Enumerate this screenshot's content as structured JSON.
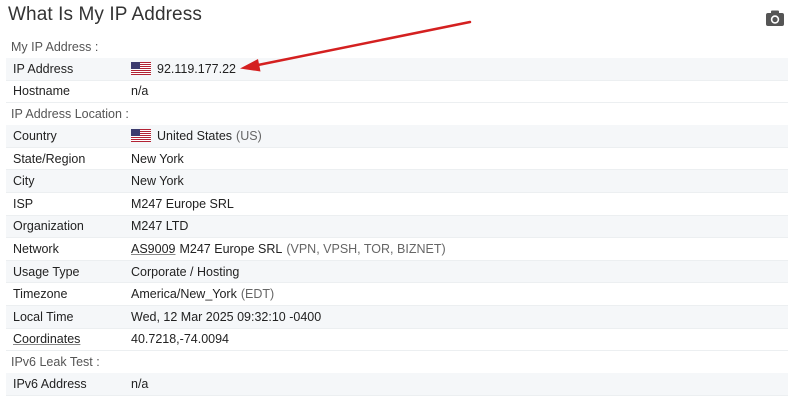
{
  "page": {
    "title": "What Is My IP Address"
  },
  "toolbar": {
    "screenshot_icon": "camera-icon"
  },
  "sections": {
    "my_ip": {
      "header": "My IP Address :",
      "ip_label": "IP Address",
      "ip_value": "92.119.177.22",
      "hostname_label": "Hostname",
      "hostname_value": "n/a"
    },
    "location": {
      "header": "IP Address Location :",
      "country_label": "Country",
      "country_value": "United States",
      "country_code": "(US)",
      "state_label": "State/Region",
      "state_value": "New York",
      "city_label": "City",
      "city_value": "New York",
      "isp_label": "ISP",
      "isp_value": "M247 Europe SRL",
      "org_label": "Organization",
      "org_value": "M247 LTD",
      "network_label": "Network",
      "network_as": "AS9009",
      "network_name": "M247 Europe SRL",
      "network_tags": "(VPN, VPSH, TOR, BIZNET)",
      "usage_label": "Usage Type",
      "usage_value": "Corporate / Hosting",
      "timezone_label": "Timezone",
      "timezone_value": "America/New_York",
      "timezone_abbr": "(EDT)",
      "localtime_label": "Local Time",
      "localtime_value": "Wed, 12 Mar 2025 09:32:10 -0400",
      "coords_label": "Coordinates",
      "coords_value": "40.7218,-74.0094"
    },
    "ipv6": {
      "header": "IPv6 Leak Test :",
      "ipv6_label": "IPv6 Address",
      "ipv6_value": "n/a"
    }
  },
  "colors": {
    "arrow": "#d42020",
    "row_alt": "#f5f7f9",
    "title": "#333333"
  }
}
